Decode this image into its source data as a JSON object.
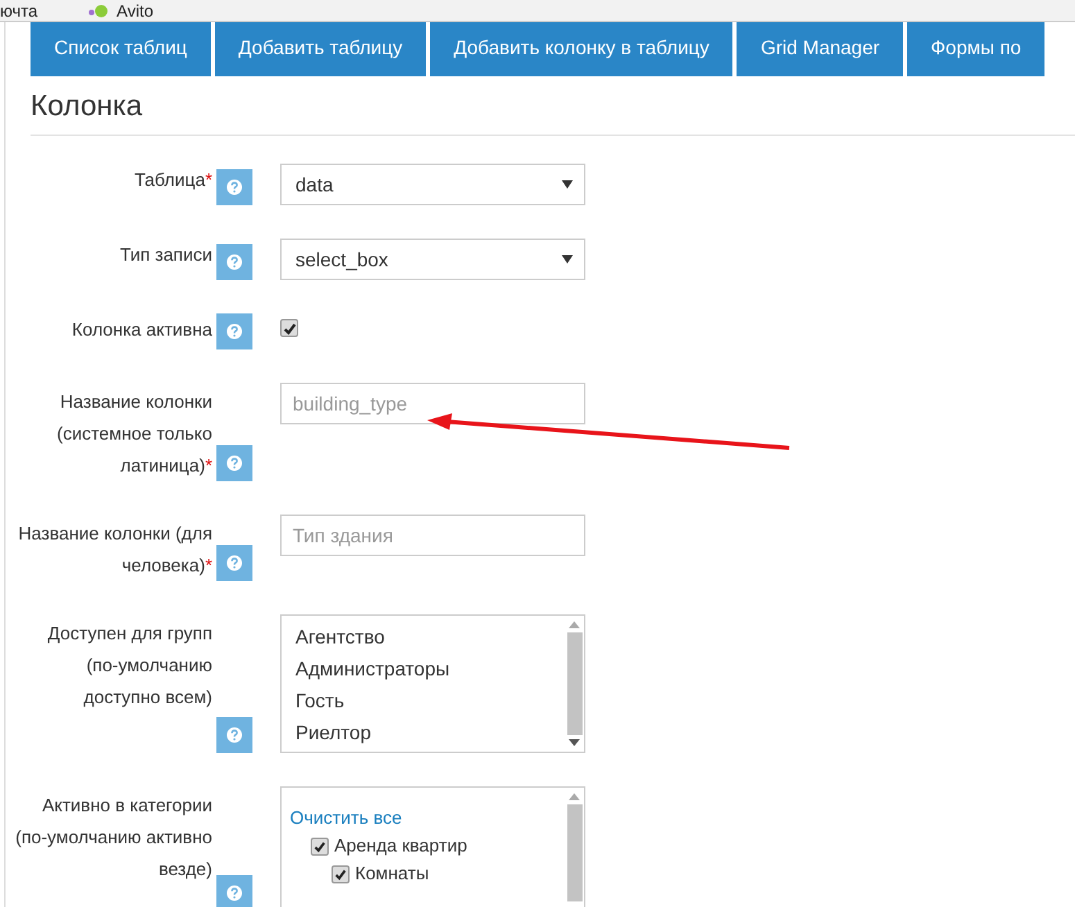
{
  "bookmarks": [
    {
      "label": "ючта",
      "kind": "plain"
    },
    {
      "label": "Avito",
      "kind": "dots"
    }
  ],
  "nav_tabs": [
    {
      "label": "Список таблиц"
    },
    {
      "label": "Добавить таблицу"
    },
    {
      "label": "Добавить колонку в таблицу"
    },
    {
      "label": "Grid Manager"
    },
    {
      "label": "Формы по"
    }
  ],
  "heading": "Колонка",
  "fields": [
    {
      "kind": "select",
      "label": "Таблица",
      "required_mark": "*",
      "value": "data"
    },
    {
      "kind": "select",
      "label": "Тип записи",
      "value": "select_box"
    },
    {
      "kind": "checkbox",
      "label": "Колонка активна",
      "checked": true
    },
    {
      "kind": "text",
      "label": "Название колонки (системное только латиница)",
      "required_mark": "*",
      "placeholder": "building_type"
    },
    {
      "kind": "text",
      "label": "Название колонки (для человека)",
      "required_mark": "*",
      "placeholder": "Тип здания"
    },
    {
      "kind": "listbox",
      "label": "Доступен для групп (по-умолчанию доступно всем)",
      "options": [
        "Агентство",
        "Администраторы",
        "Гость",
        "Риелтор"
      ]
    },
    {
      "kind": "tree",
      "label": "Активно в категории (по-умолчанию активно везде)",
      "clear_link": "Очистить все",
      "items": [
        {
          "label": "Аренда квартир",
          "checked": true,
          "children": [
            {
              "label": "Комнаты",
              "checked": true
            }
          ]
        }
      ]
    }
  ]
}
